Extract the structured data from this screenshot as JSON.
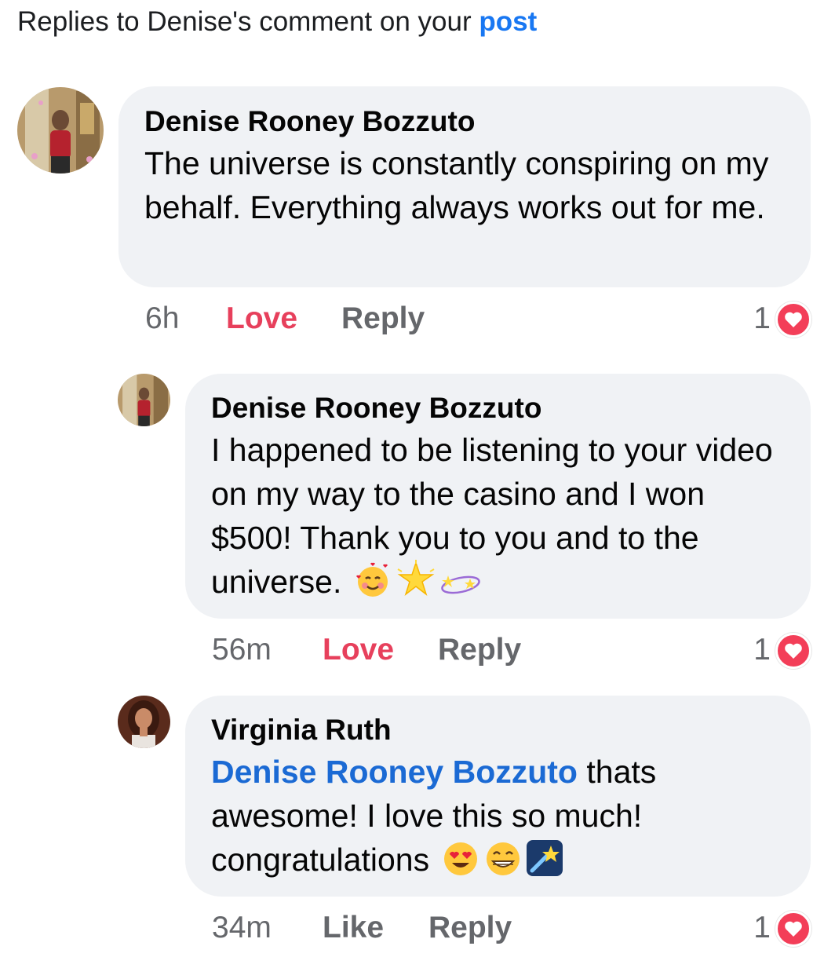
{
  "header": {
    "prefix": "Replies to Denise's comment on your",
    "link": "post"
  },
  "comments": [
    {
      "author": "Denise Rooney Bozzuto",
      "text": "The universe is constantly conspiring on my behalf. Everything always works out for me.",
      "time": "6h",
      "reaction_button": "Love",
      "reply_label": "Reply",
      "reaction_count": "1",
      "reaction_icon": "heart-icon",
      "avatar_icon": "profile-photo"
    },
    {
      "author": "Denise Rooney Bozzuto",
      "text": "I happened to be listening to your video on my way to the casino and I won $500! Thank you to you and to the universe.",
      "emojis": [
        "smiling-face-with-hearts",
        "glowing-star",
        "dizzy"
      ],
      "time": "56m",
      "reaction_button": "Love",
      "reply_label": "Reply",
      "reaction_count": "1",
      "reaction_icon": "heart-icon",
      "avatar_icon": "profile-photo"
    },
    {
      "author": "Virginia Ruth",
      "mention": "Denise Rooney Bozzuto",
      "text": " thats awesome! I love this so much! congratulations",
      "emojis": [
        "heart-eyes",
        "beaming-face",
        "shooting-star"
      ],
      "time": "34m",
      "reaction_button": "Like",
      "reply_label": "Reply",
      "reaction_count": "1",
      "reaction_icon": "heart-icon",
      "avatar_icon": "profile-photo"
    }
  ],
  "colors": {
    "link": "#1877f2",
    "mention": "#1b6ad4",
    "love": "#e7405c",
    "muted": "#65676b",
    "bubble": "#f0f2f5",
    "heart_badge": "#f33e58"
  }
}
